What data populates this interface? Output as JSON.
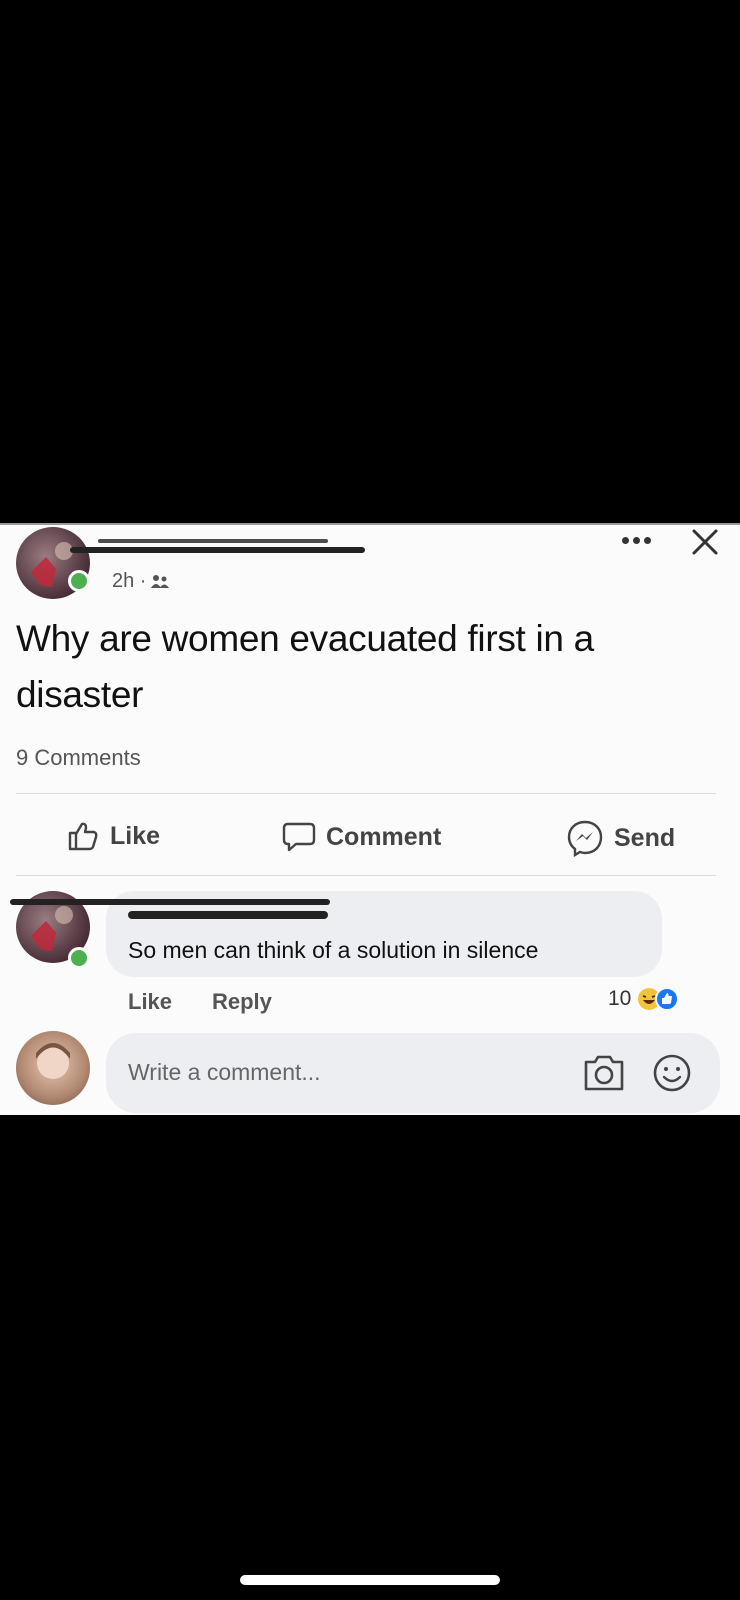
{
  "post": {
    "time": "2h · ",
    "audience_icon": "friends-icon",
    "text": "Why are women evacuated first in a disaster",
    "comments_count": "9 Comments"
  },
  "actions": {
    "like": "Like",
    "comment": "Comment",
    "send": "Send"
  },
  "comment": {
    "text": "So men can think of a solution in silence",
    "like": "Like",
    "reply": "Reply",
    "reaction_count": "10"
  },
  "composer": {
    "placeholder": "Write a comment..."
  },
  "icons": [
    "more-icon",
    "close-icon",
    "like-icon",
    "comment-icon",
    "messenger-icon",
    "camera-icon",
    "emoji-icon"
  ],
  "colors": {
    "online": "#4caf50",
    "haha": "#f5c33b",
    "like_blue": "#1877f2"
  }
}
